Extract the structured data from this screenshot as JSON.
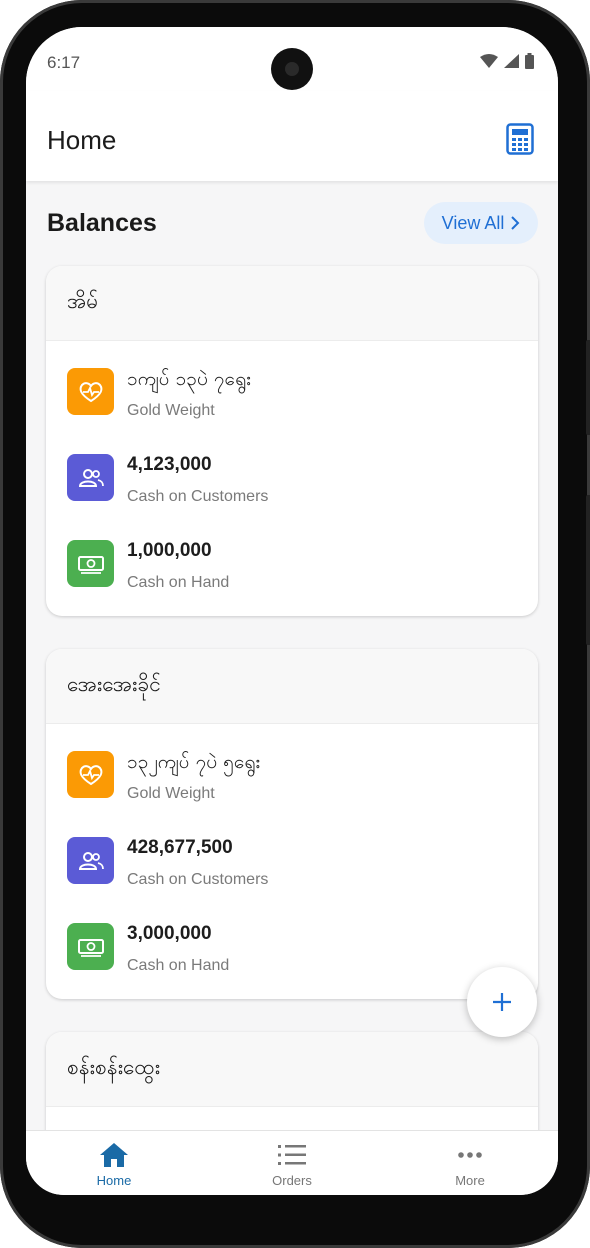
{
  "status": {
    "time": "6:17"
  },
  "appbar": {
    "title": "Home"
  },
  "balances": {
    "title": "Balances",
    "view_all": "View All"
  },
  "cards": [
    {
      "name": "အိမ်",
      "gold": "၁ကျပ် ၁၃ပဲ ၇ရွေး",
      "gold_label": "Gold Weight",
      "customers": "4,123,000",
      "customers_label": "Cash on Customers",
      "hand": "1,000,000",
      "hand_label": "Cash on Hand"
    },
    {
      "name": "အေးအေးခိုင်",
      "gold": "၁၃၂ကျပ် ၇ပဲ ၅ရွေး",
      "gold_label": "Gold Weight",
      "customers": "428,677,500",
      "customers_label": "Cash on Customers",
      "hand": "3,000,000",
      "hand_label": "Cash on Hand"
    },
    {
      "name": "စန်းစန်းထွေး"
    }
  ],
  "nav": [
    {
      "label": "Home",
      "icon": "home-icon"
    },
    {
      "label": "Orders",
      "icon": "list-icon"
    },
    {
      "label": "More",
      "icon": "more-icon"
    }
  ],
  "colors": {
    "gold": "#fb9a05",
    "customers": "#5b5bd6",
    "hand": "#4caf50",
    "accent": "#1f6fd4"
  }
}
